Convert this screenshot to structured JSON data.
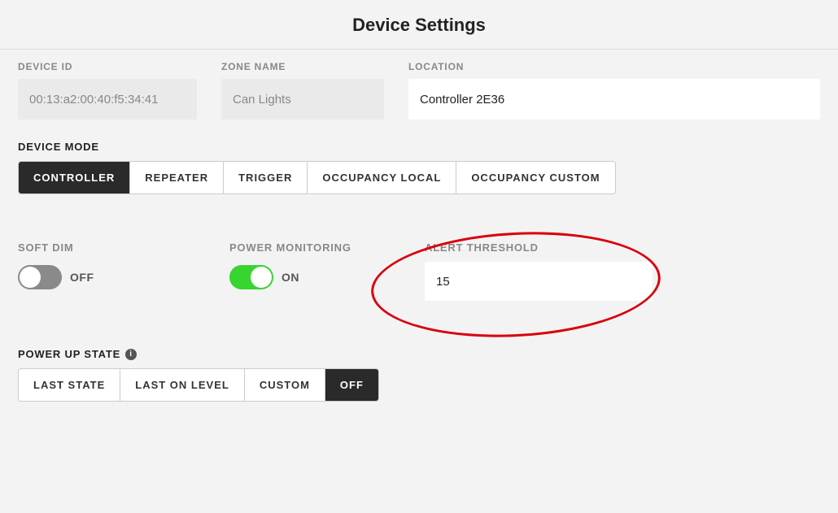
{
  "header": {
    "title": "Device Settings"
  },
  "fields": {
    "device_id": {
      "label": "DEVICE ID",
      "value": "00:13:a2:00:40:f5:34:41"
    },
    "zone_name": {
      "label": "ZONE NAME",
      "value": "Can Lights"
    },
    "location": {
      "label": "LOCATION",
      "value": "Controller 2E36"
    }
  },
  "device_mode": {
    "label": "DEVICE MODE",
    "options": [
      "CONTROLLER",
      "REPEATER",
      "TRIGGER",
      "OCCUPANCY LOCAL",
      "OCCUPANCY CUSTOM"
    ],
    "selected": "CONTROLLER"
  },
  "soft_dim": {
    "label": "SOFT DIM",
    "state": "OFF"
  },
  "power_monitoring": {
    "label": "POWER MONITORING",
    "state": "ON"
  },
  "alert_threshold": {
    "label": "ALERT THRESHOLD",
    "value": "15"
  },
  "power_up_state": {
    "label": "POWER UP STATE",
    "options": [
      "LAST STATE",
      "LAST ON LEVEL",
      "CUSTOM",
      "OFF"
    ],
    "selected": "OFF"
  }
}
